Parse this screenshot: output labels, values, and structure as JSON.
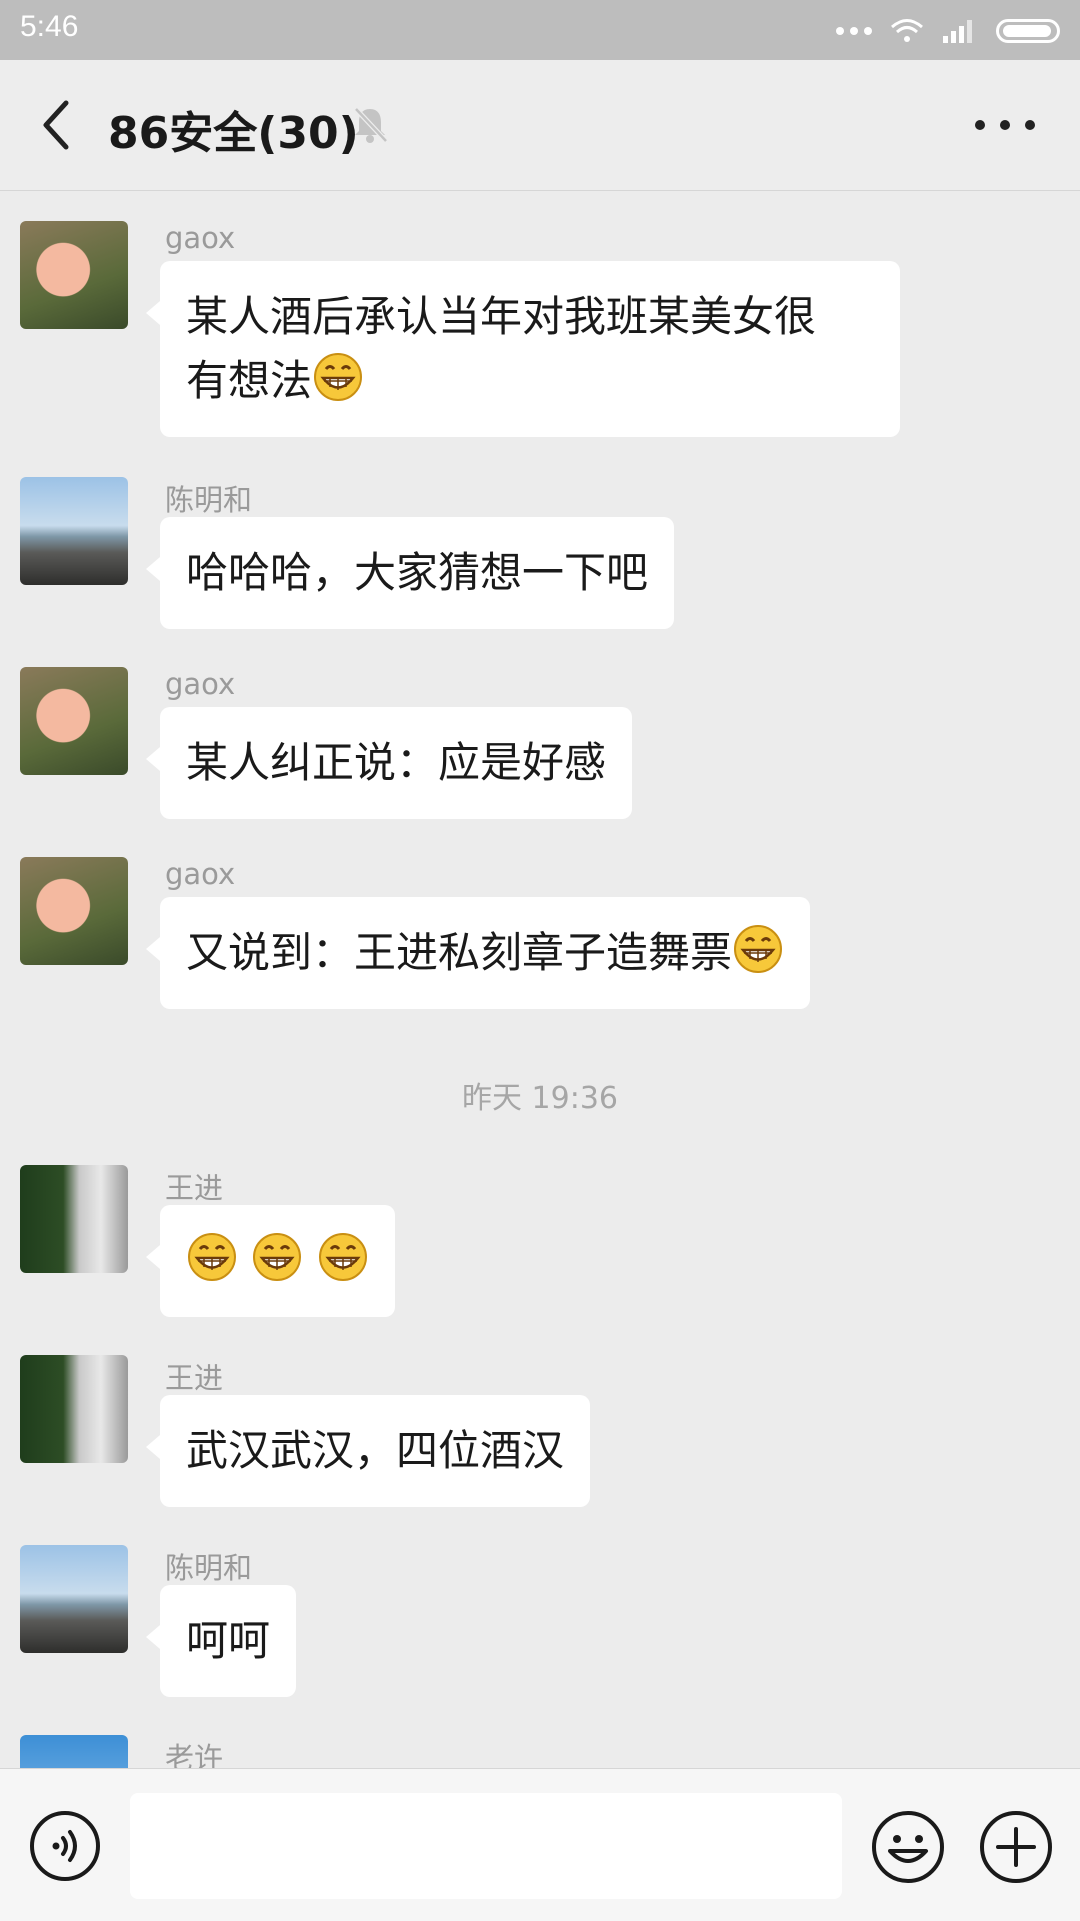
{
  "status_bar": {
    "time": "5:46"
  },
  "header": {
    "title": "86安全(30)"
  },
  "messages": [
    {
      "sender": "gaox",
      "text": "某人酒后承认当年对我班某美女很",
      "text_line2": "有想法",
      "emoji": "grin"
    },
    {
      "sender": "陈明和",
      "text": "哈哈哈，大家猜想一下吧"
    },
    {
      "sender": "gaox",
      "text": "某人纠正说：应是好感"
    },
    {
      "sender": "gaox",
      "text": "又说到：王进私刻章子造舞票",
      "emoji": "grin"
    },
    {
      "sender": "王进",
      "emoji_count": 3,
      "emoji": "grin"
    },
    {
      "sender": "王进",
      "text": "武汉武汉，四位酒汉"
    },
    {
      "sender": "陈明和",
      "text": "呵呵"
    },
    {
      "sender": "老许"
    }
  ],
  "timestamp": "昨天 19:36",
  "input": {
    "value": "",
    "placeholder": ""
  },
  "icons": {
    "back": "back-chevron-icon",
    "mute": "mute-bell-icon",
    "more": "more-dots-icon",
    "voice": "voice-icon",
    "emoji": "emoji-icon",
    "plus": "plus-icon"
  },
  "colors": {
    "bubble": "#ffffff",
    "background": "#ececec",
    "header": "#ededed"
  }
}
